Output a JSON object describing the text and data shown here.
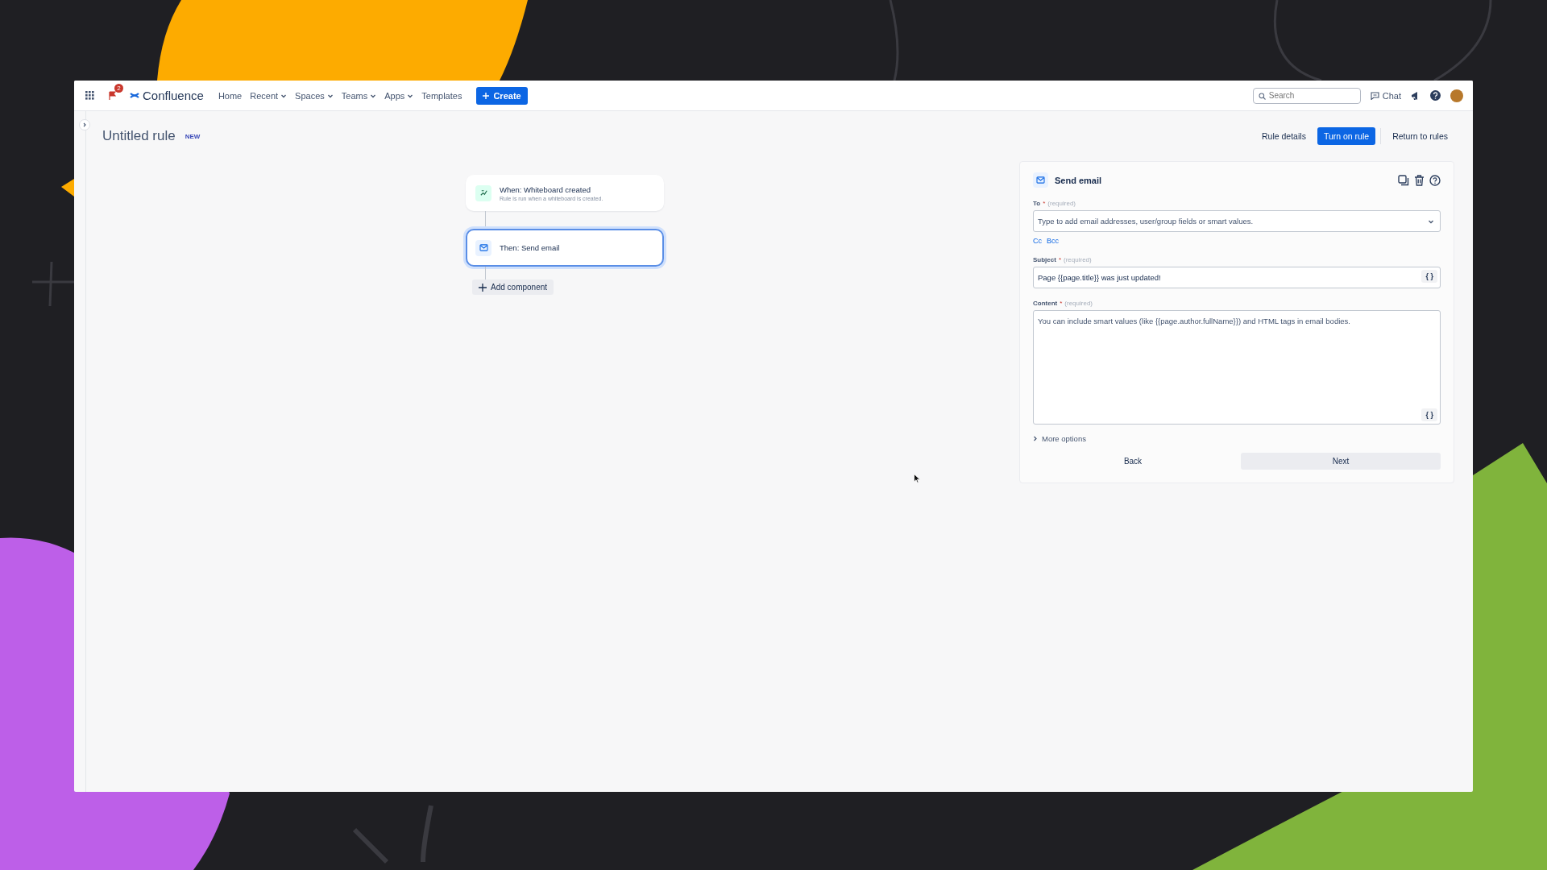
{
  "nav": {
    "notification_count": "2",
    "product": "Confluence",
    "items": [
      {
        "label": "Home",
        "dropdown": false
      },
      {
        "label": "Recent",
        "dropdown": true
      },
      {
        "label": "Spaces",
        "dropdown": true
      },
      {
        "label": "Teams",
        "dropdown": true
      },
      {
        "label": "Apps",
        "dropdown": true
      },
      {
        "label": "Templates",
        "dropdown": false
      }
    ],
    "create": "Create",
    "search": {
      "placeholder": "Search"
    },
    "chat": "Chat"
  },
  "header": {
    "title": "Untitled rule",
    "badge": "NEW",
    "actions": [
      {
        "label": "Rule details",
        "kind": "subtle"
      },
      {
        "label": "Turn on rule",
        "kind": "primary"
      },
      {
        "label": "Return to rules",
        "kind": "separated"
      }
    ]
  },
  "flow": {
    "nodes": [
      {
        "kind": "trigger",
        "title": "When: Whiteboard created",
        "description": "Rule is run when a whiteboard is created.",
        "selected": false
      },
      {
        "kind": "action",
        "title": "Then: Send email",
        "selected": true
      }
    ],
    "add": "Add component"
  },
  "panel": {
    "title": "Send email",
    "fields": [
      {
        "kind": "select",
        "label": "To",
        "mark": "*",
        "hint": "(required)",
        "placeholder": "Type to add email addresses, user/group fields or smart values."
      },
      {
        "kind": "links",
        "links": [
          "Cc",
          "Bcc"
        ]
      },
      {
        "kind": "text",
        "label": "Subject",
        "mark": "*",
        "hint": "(required)",
        "value": "Page {{page.title}} was just updated!",
        "insert": "{ }"
      },
      {
        "kind": "textarea",
        "label": "Content",
        "mark": "*",
        "hint": "(required)",
        "placeholder": "You can include smart values (like {{page.author.fullName}}) and HTML tags in email bodies.",
        "insert": "{ }"
      }
    ],
    "more_options": "More options",
    "buttons": [
      {
        "label": "Back",
        "kind": "subtle"
      },
      {
        "label": "Next",
        "kind": "filled"
      }
    ]
  }
}
